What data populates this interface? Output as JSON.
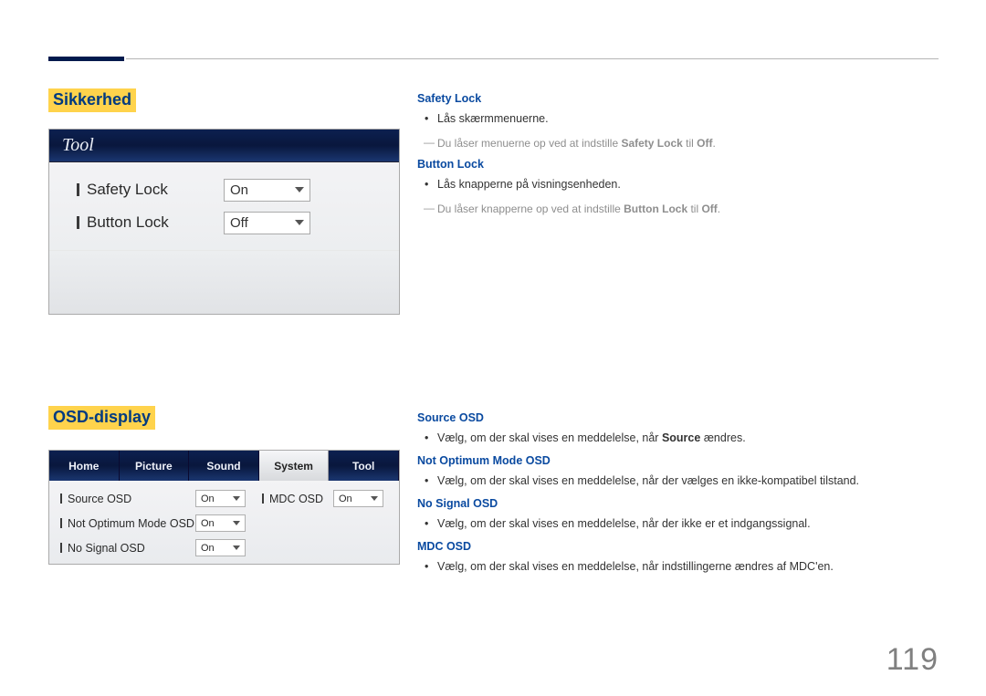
{
  "page_number": "119",
  "section1": {
    "heading": "Sikkerhed",
    "panel_title": "Tool",
    "rows": [
      {
        "label": "Safety Lock",
        "value": "On"
      },
      {
        "label": "Button Lock",
        "value": "Off"
      }
    ],
    "desc": {
      "safety_lock": {
        "heading": "Safety Lock",
        "bullet": "Lås skærmmenuerne.",
        "note_pre": "Du låser menuerne op ved at indstille ",
        "note_bold1": "Safety Lock",
        "note_mid": " til ",
        "note_bold2": "Off",
        "note_post": "."
      },
      "button_lock": {
        "heading": "Button Lock",
        "bullet": "Lås knapperne på visningsenheden.",
        "note_pre": "Du låser knapperne op ved at indstille ",
        "note_bold1": "Button Lock",
        "note_mid": " til ",
        "note_bold2": "Off",
        "note_post": "."
      }
    }
  },
  "section2": {
    "heading": "OSD-display",
    "tabs": [
      "Home",
      "Picture",
      "Sound",
      "System",
      "Tool"
    ],
    "active_tab_index": 3,
    "rows_left": [
      {
        "label": "Source OSD",
        "value": "On"
      },
      {
        "label": "Not Optimum Mode OSD",
        "value": "On"
      },
      {
        "label": "No Signal OSD",
        "value": "On"
      }
    ],
    "rows_right": [
      {
        "label": "MDC OSD",
        "value": "On"
      }
    ],
    "desc": {
      "source_osd": {
        "heading": "Source OSD",
        "bullet_pre": "Vælg, om der skal vises en meddelelse, når ",
        "bullet_bold": "Source",
        "bullet_post": " ændres."
      },
      "not_optimum": {
        "heading": "Not Optimum Mode OSD",
        "bullet": "Vælg, om der skal vises en meddelelse, når der vælges en ikke-kompatibel tilstand."
      },
      "no_signal": {
        "heading": "No Signal OSD",
        "bullet": "Vælg, om der skal vises en meddelelse, når der ikke er et indgangssignal."
      },
      "mdc_osd": {
        "heading": "MDC OSD",
        "bullet": "Vælg, om der skal vises en meddelelse, når indstillingerne ændres af MDC'en."
      }
    }
  }
}
